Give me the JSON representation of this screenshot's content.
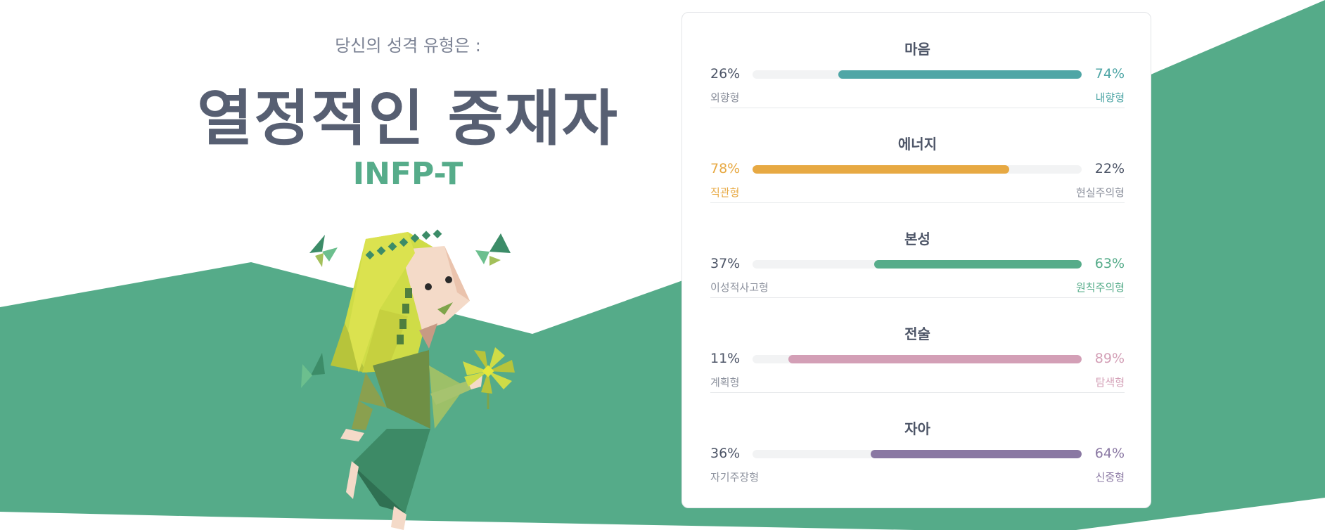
{
  "hero": {
    "subtitle": "당신의 성격 유형은 :",
    "type_name": "열정적인 중재자",
    "type_code": "INFP-T"
  },
  "colors": {
    "background_green": "#55ab89",
    "mind": "#4fa6a6",
    "energy": "#e7a943",
    "nature": "#56ac8a",
    "tactics": "#d39fb6",
    "identity": "#8a78a3",
    "neutral_text": "#4d5567"
  },
  "traits": [
    {
      "title": "마음",
      "left_pct": "26%",
      "right_pct": "74%",
      "left_label": "외향형",
      "right_label": "내향형",
      "dominant": "right",
      "dominant_value": 0.74,
      "color": "#4fa6a6"
    },
    {
      "title": "에너지",
      "left_pct": "78%",
      "right_pct": "22%",
      "left_label": "직관형",
      "right_label": "현실주의형",
      "dominant": "left",
      "dominant_value": 0.78,
      "color": "#e7a943"
    },
    {
      "title": "본성",
      "left_pct": "37%",
      "right_pct": "63%",
      "left_label": "이성적사고형",
      "right_label": "원칙주의형",
      "dominant": "right",
      "dominant_value": 0.63,
      "color": "#56ac8a"
    },
    {
      "title": "전술",
      "left_pct": "11%",
      "right_pct": "89%",
      "left_label": "계획형",
      "right_label": "탐색형",
      "dominant": "right",
      "dominant_value": 0.89,
      "color": "#d39fb6"
    },
    {
      "title": "자아",
      "left_pct": "36%",
      "right_pct": "64%",
      "left_label": "자기주장형",
      "right_label": "신중형",
      "dominant": "right",
      "dominant_value": 0.64,
      "color": "#8a78a3"
    }
  ]
}
